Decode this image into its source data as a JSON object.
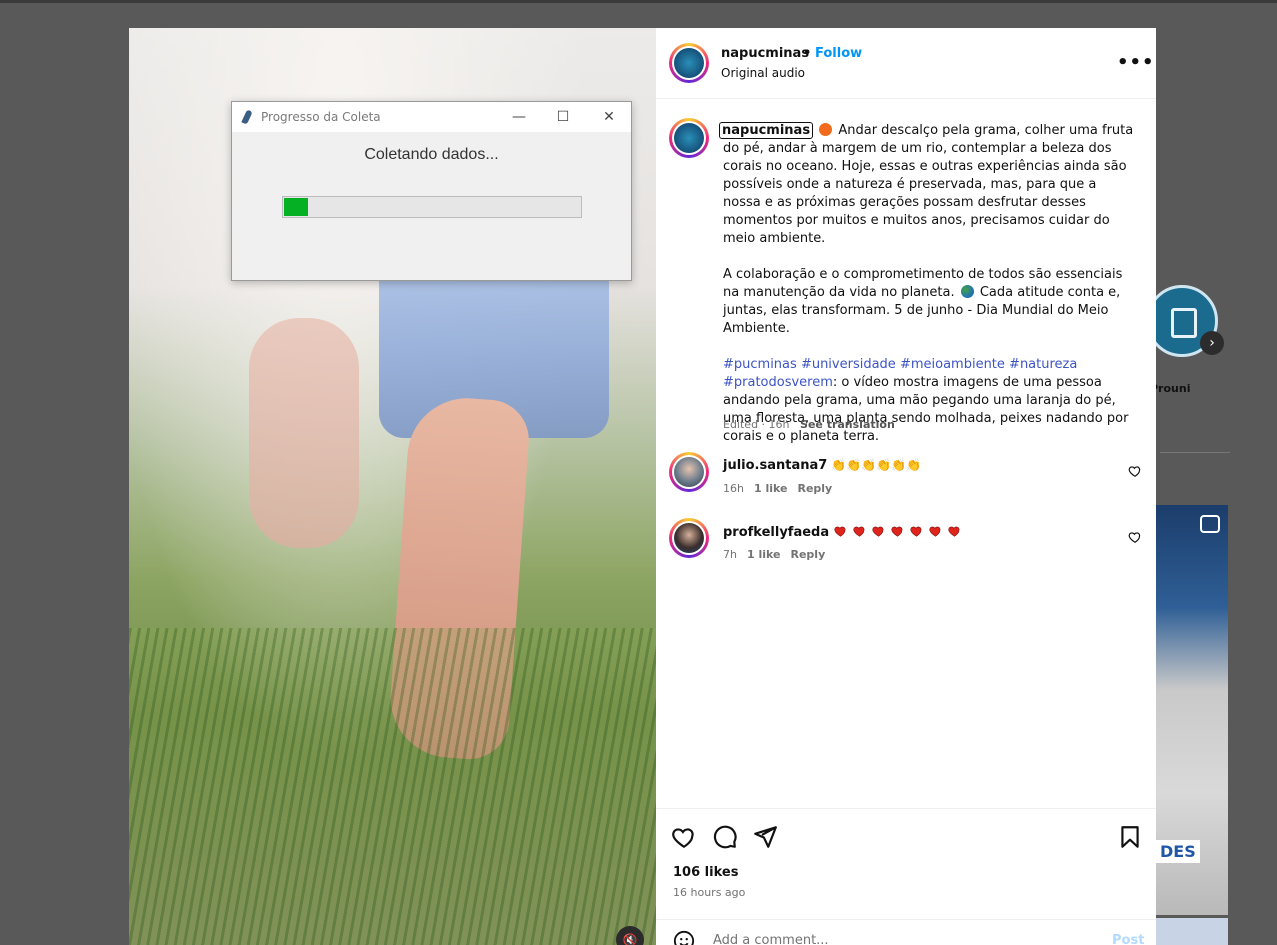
{
  "background": {
    "story_label": "Prouni",
    "story_arrow": "›",
    "thumb_badge": "DES"
  },
  "video": {
    "mute_icon": "🔇"
  },
  "dialog": {
    "title": "Progresso da Coleta",
    "minimize": "—",
    "maximize": "☐",
    "close": "✕",
    "message": "Coletando dados...",
    "progress_value": 0.08
  },
  "post": {
    "author": "napucminas",
    "separator": "•",
    "follow_label": "Follow",
    "audio": "Original audio",
    "more": "•••",
    "caption": {
      "username": "napucminas",
      "p1": "Andar descalço pela grama, colher uma fruta do pé, andar à margem de um rio, contemplar a beleza dos corais no oceano. Hoje, essas e outras experiências ainda são possíveis onde a natureza é preservada, mas, para que a nossa e as próximas gerações possam desfrutar desses momentos por muitos e muitos anos, precisamos cuidar do meio ambiente.",
      "p2a": "A colaboração e o comprometimento de todos são essenciais na manutenção da vida no planeta.",
      "p2b": "Cada atitude conta e, juntas, elas transformam. 5 de junho - Dia Mundial do Meio Ambiente.",
      "hashtags": [
        "#pucminas",
        "#universidade",
        "#meioambiente",
        "#natureza"
      ],
      "hashtag_pdv": "#pratodosverem",
      "p3": ": o vídeo mostra imagens de uma pessoa andando pela grama, uma mão pegando uma laranja do pé, uma floresta, uma planta sendo molhada, peixes nadando por corais e o planeta terra."
    },
    "edited": "Edited · 16h",
    "see_translation": "See translation",
    "comments": [
      {
        "user": "julio.santana7",
        "text": "👏👏👏👏👏👏",
        "time": "16h",
        "likes": "1 like",
        "reply": "Reply"
      },
      {
        "user": "profkellyfaeda",
        "text": "",
        "hearts": 7,
        "time": "7h",
        "likes": "1 like",
        "reply": "Reply"
      }
    ],
    "likes": "106 likes",
    "ago": "16 hours ago",
    "add_comment_placeholder": "Add a comment...",
    "post_label": "Post"
  },
  "colors": {
    "accent": "#0095f6",
    "hashtag": "#3d55c3",
    "progress": "#06b025",
    "heart": "#e0241b"
  }
}
